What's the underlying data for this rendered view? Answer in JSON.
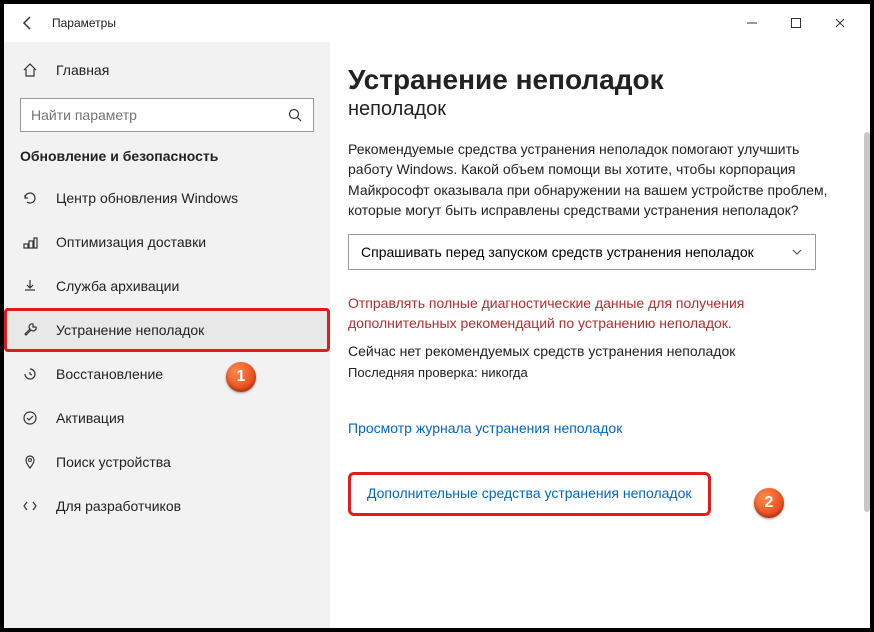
{
  "titlebar": {
    "title": "Параметры"
  },
  "sidebar": {
    "home": "Главная",
    "search_placeholder": "Найти параметр",
    "category": "Обновление и безопасность",
    "items": [
      {
        "label": "Центр обновления Windows"
      },
      {
        "label": "Оптимизация доставки"
      },
      {
        "label": "Служба архивации"
      },
      {
        "label": "Устранение неполадок"
      },
      {
        "label": "Восстановление"
      },
      {
        "label": "Активация"
      },
      {
        "label": "Поиск устройства"
      },
      {
        "label": "Для разработчиков"
      }
    ]
  },
  "main": {
    "heading": "Устранение неполадок",
    "subheading": "неполадок",
    "description": "Рекомендуемые средства устранения неполадок помогают улучшить работу Windows. Какой объем помощи вы хотите, чтобы корпорация Майкрософт оказывала при обнаружении на вашем устройстве проблем, которые могут быть исправлены средствами устранения неполадок?",
    "dropdown_value": "Спрашивать перед запуском средств устранения неполадок",
    "warning": "Отправлять полные диагностические данные для получения дополнительных рекомендаций по устранению неполадок.",
    "no_rec": "Сейчас нет рекомендуемых средств устранения неполадок",
    "last_check": "Последняя проверка: никогда",
    "link_history": "Просмотр журнала устранения неполадок",
    "link_more": "Дополнительные средства устранения неполадок"
  },
  "badges": {
    "one": "1",
    "two": "2"
  }
}
